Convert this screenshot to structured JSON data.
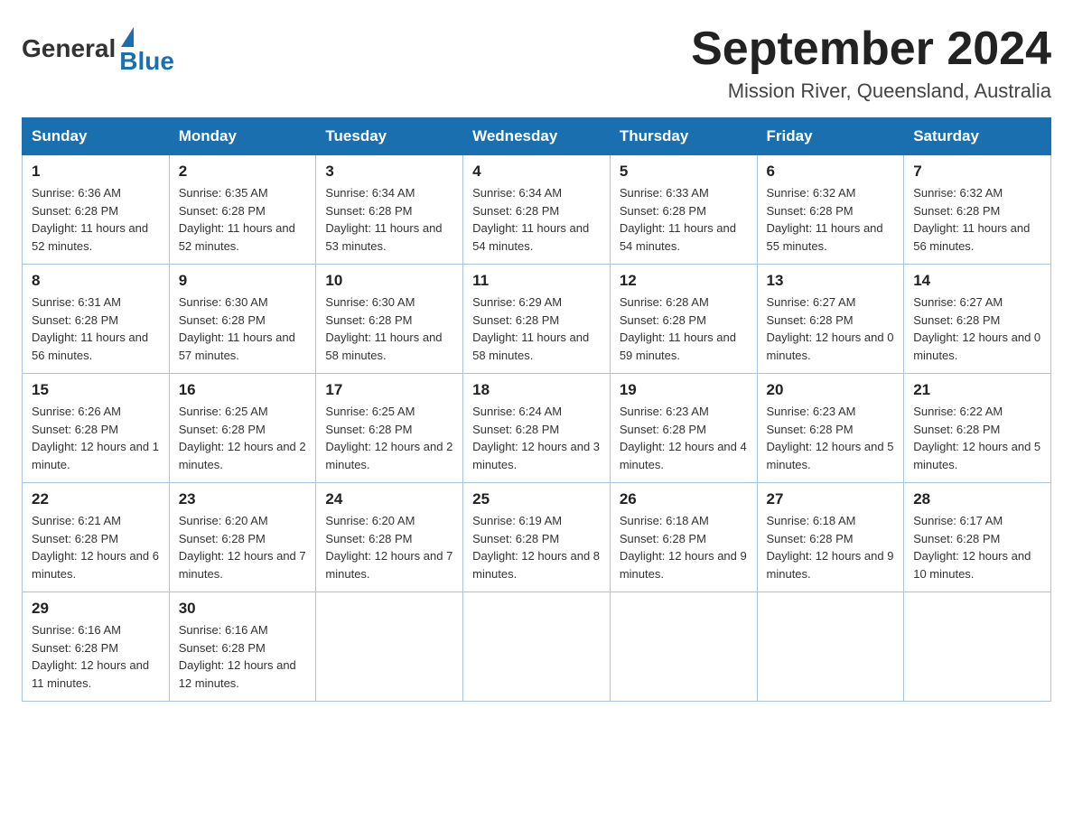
{
  "header": {
    "logo_general": "General",
    "logo_blue": "Blue",
    "title": "September 2024",
    "subtitle": "Mission River, Queensland, Australia"
  },
  "columns": [
    "Sunday",
    "Monday",
    "Tuesday",
    "Wednesday",
    "Thursday",
    "Friday",
    "Saturday"
  ],
  "weeks": [
    [
      {
        "day": "1",
        "sunrise": "6:36 AM",
        "sunset": "6:28 PM",
        "daylight": "11 hours and 52 minutes."
      },
      {
        "day": "2",
        "sunrise": "6:35 AM",
        "sunset": "6:28 PM",
        "daylight": "11 hours and 52 minutes."
      },
      {
        "day": "3",
        "sunrise": "6:34 AM",
        "sunset": "6:28 PM",
        "daylight": "11 hours and 53 minutes."
      },
      {
        "day": "4",
        "sunrise": "6:34 AM",
        "sunset": "6:28 PM",
        "daylight": "11 hours and 54 minutes."
      },
      {
        "day": "5",
        "sunrise": "6:33 AM",
        "sunset": "6:28 PM",
        "daylight": "11 hours and 54 minutes."
      },
      {
        "day": "6",
        "sunrise": "6:32 AM",
        "sunset": "6:28 PM",
        "daylight": "11 hours and 55 minutes."
      },
      {
        "day": "7",
        "sunrise": "6:32 AM",
        "sunset": "6:28 PM",
        "daylight": "11 hours and 56 minutes."
      }
    ],
    [
      {
        "day": "8",
        "sunrise": "6:31 AM",
        "sunset": "6:28 PM",
        "daylight": "11 hours and 56 minutes."
      },
      {
        "day": "9",
        "sunrise": "6:30 AM",
        "sunset": "6:28 PM",
        "daylight": "11 hours and 57 minutes."
      },
      {
        "day": "10",
        "sunrise": "6:30 AM",
        "sunset": "6:28 PM",
        "daylight": "11 hours and 58 minutes."
      },
      {
        "day": "11",
        "sunrise": "6:29 AM",
        "sunset": "6:28 PM",
        "daylight": "11 hours and 58 minutes."
      },
      {
        "day": "12",
        "sunrise": "6:28 AM",
        "sunset": "6:28 PM",
        "daylight": "11 hours and 59 minutes."
      },
      {
        "day": "13",
        "sunrise": "6:27 AM",
        "sunset": "6:28 PM",
        "daylight": "12 hours and 0 minutes."
      },
      {
        "day": "14",
        "sunrise": "6:27 AM",
        "sunset": "6:28 PM",
        "daylight": "12 hours and 0 minutes."
      }
    ],
    [
      {
        "day": "15",
        "sunrise": "6:26 AM",
        "sunset": "6:28 PM",
        "daylight": "12 hours and 1 minute."
      },
      {
        "day": "16",
        "sunrise": "6:25 AM",
        "sunset": "6:28 PM",
        "daylight": "12 hours and 2 minutes."
      },
      {
        "day": "17",
        "sunrise": "6:25 AM",
        "sunset": "6:28 PM",
        "daylight": "12 hours and 2 minutes."
      },
      {
        "day": "18",
        "sunrise": "6:24 AM",
        "sunset": "6:28 PM",
        "daylight": "12 hours and 3 minutes."
      },
      {
        "day": "19",
        "sunrise": "6:23 AM",
        "sunset": "6:28 PM",
        "daylight": "12 hours and 4 minutes."
      },
      {
        "day": "20",
        "sunrise": "6:23 AM",
        "sunset": "6:28 PM",
        "daylight": "12 hours and 5 minutes."
      },
      {
        "day": "21",
        "sunrise": "6:22 AM",
        "sunset": "6:28 PM",
        "daylight": "12 hours and 5 minutes."
      }
    ],
    [
      {
        "day": "22",
        "sunrise": "6:21 AM",
        "sunset": "6:28 PM",
        "daylight": "12 hours and 6 minutes."
      },
      {
        "day": "23",
        "sunrise": "6:20 AM",
        "sunset": "6:28 PM",
        "daylight": "12 hours and 7 minutes."
      },
      {
        "day": "24",
        "sunrise": "6:20 AM",
        "sunset": "6:28 PM",
        "daylight": "12 hours and 7 minutes."
      },
      {
        "day": "25",
        "sunrise": "6:19 AM",
        "sunset": "6:28 PM",
        "daylight": "12 hours and 8 minutes."
      },
      {
        "day": "26",
        "sunrise": "6:18 AM",
        "sunset": "6:28 PM",
        "daylight": "12 hours and 9 minutes."
      },
      {
        "day": "27",
        "sunrise": "6:18 AM",
        "sunset": "6:28 PM",
        "daylight": "12 hours and 9 minutes."
      },
      {
        "day": "28",
        "sunrise": "6:17 AM",
        "sunset": "6:28 PM",
        "daylight": "12 hours and 10 minutes."
      }
    ],
    [
      {
        "day": "29",
        "sunrise": "6:16 AM",
        "sunset": "6:28 PM",
        "daylight": "12 hours and 11 minutes."
      },
      {
        "day": "30",
        "sunrise": "6:16 AM",
        "sunset": "6:28 PM",
        "daylight": "12 hours and 12 minutes."
      },
      null,
      null,
      null,
      null,
      null
    ]
  ]
}
